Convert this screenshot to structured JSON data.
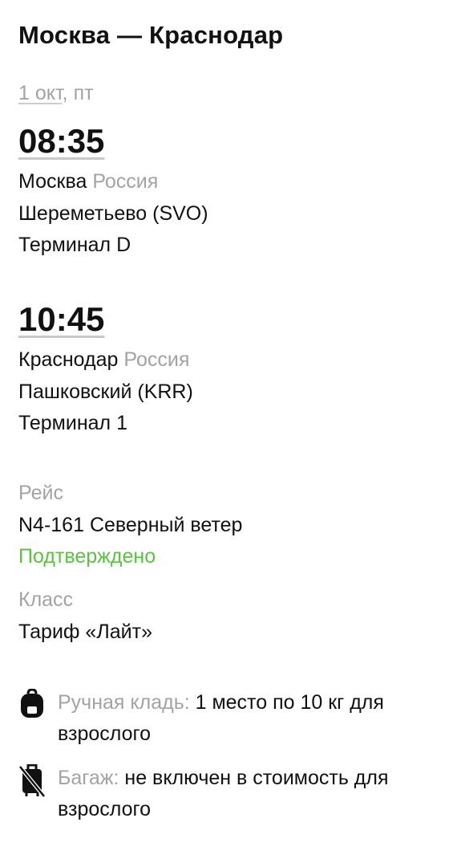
{
  "route": {
    "title": "Москва — Краснодар"
  },
  "date": {
    "day": "1 окт",
    "separator": ", ",
    "weekday": "пт"
  },
  "departure": {
    "time": "08:35",
    "city": "Москва",
    "country": "Россия",
    "airport": "Шереметьево (SVO)",
    "terminal": "Терминал D"
  },
  "arrival": {
    "time": "10:45",
    "city": "Краснодар",
    "country": "Россия",
    "airport": "Пашковский (KRR)",
    "terminal": "Терминал 1"
  },
  "flight": {
    "label": "Рейс",
    "number": "N4-161 Северный ветер",
    "status": "Подтверждено"
  },
  "class": {
    "label": "Класс",
    "value": "Тариф «Лайт»"
  },
  "baggage": {
    "hand_label": "Ручная кладь:",
    "hand_value": " 1 место по 10 кг для взрослого",
    "checked_label": "Багаж:",
    "checked_value": " не включен в стоимость для взрослого"
  },
  "icons": {
    "hand": "backpack-icon",
    "checked": "no-luggage-icon"
  },
  "colors": {
    "muted": "#a3a3a3",
    "confirmed": "#5bc341",
    "text": "#111111"
  }
}
